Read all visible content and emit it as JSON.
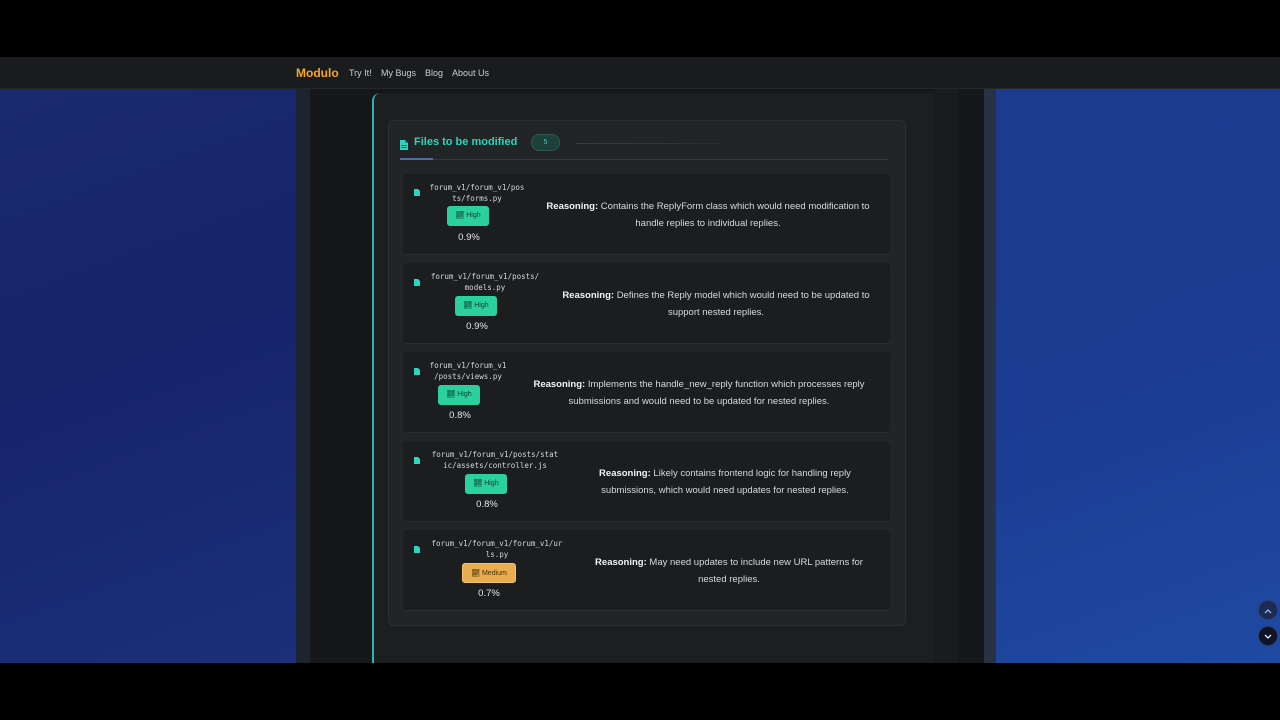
{
  "navbar": {
    "brand": "Modulo",
    "links": [
      "Try It!",
      "My Bugs",
      "Blog",
      "About Us"
    ]
  },
  "files_section": {
    "title": "Files to be modified",
    "count": "5",
    "reasoning_label": "Reasoning:",
    "files": [
      {
        "path_lines": [
          "forum_v1/forum_v1/pos",
          "ts/forms.py"
        ],
        "priority": "High",
        "percent": "0.9%",
        "reason_lines": [
          "Contains the ReplyForm class which would need modification to",
          "handle replies to individual replies."
        ]
      },
      {
        "path_lines": [
          "forum_v1/forum_v1/posts/",
          "models.py"
        ],
        "priority": "High",
        "percent": "0.9%",
        "reason_lines": [
          "Defines the Reply model which would need to be updated to",
          "support nested replies."
        ]
      },
      {
        "path_lines": [
          "forum_v1/forum_v1",
          "/posts/views.py"
        ],
        "priority": "High",
        "percent": "0.8%",
        "reason_lines": [
          "Implements the handle_new_reply function which processes reply",
          "submissions and would need to be updated for nested replies."
        ]
      },
      {
        "path_lines": [
          "forum_v1/forum_v1/posts/stat",
          "ic/assets/controller.js"
        ],
        "priority": "High",
        "percent": "0.8%",
        "reason_lines": [
          "Likely contains frontend logic for handling reply",
          "submissions, which would need updates for nested replies."
        ]
      },
      {
        "path_lines": [
          "forum_v1/forum_v1/forum_v1/ur",
          "ls.py"
        ],
        "priority": "Medium",
        "percent": "0.7%",
        "reason_lines": [
          "May need updates to include new URL patterns for",
          "nested replies."
        ]
      }
    ]
  },
  "colors": {
    "accent": "#2dd4bf",
    "brand": "#f5a623",
    "high_badge": "#2bd19c",
    "medium_badge": "#e7ad4f"
  },
  "icons": {
    "files_header": "file-icon",
    "row": "file-icon",
    "badge": "chart-icon",
    "scroll_up": "chevron-up-icon",
    "scroll_down": "chevron-down-icon"
  }
}
